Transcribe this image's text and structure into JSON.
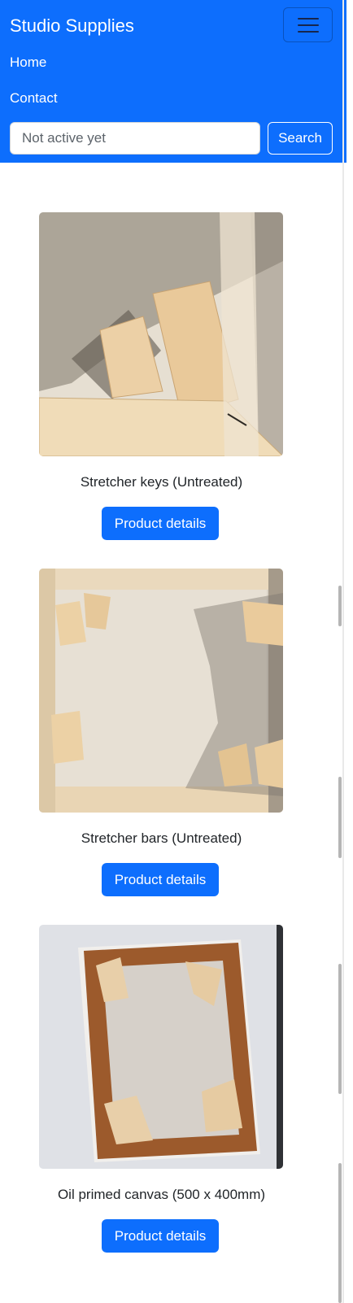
{
  "navbar": {
    "brand": "Studio Supplies",
    "links": [
      {
        "label": "Home"
      },
      {
        "label": "Contact"
      }
    ],
    "search": {
      "placeholder": "Not active yet",
      "value": "",
      "button_label": "Search"
    }
  },
  "products": [
    {
      "name": "Stretcher keys (Untreated)",
      "button_label": "Product details",
      "image": "stretcher-keys-photo"
    },
    {
      "name": "Stretcher bars (Untreated)",
      "button_label": "Product details",
      "image": "stretcher-bars-photo"
    },
    {
      "name": "Oil primed canvas (500 x 400mm)",
      "button_label": "Product details",
      "image": "oil-primed-canvas-photo"
    }
  ],
  "colors": {
    "accent": "#0d6efd",
    "text": "#212529",
    "page_background": "#ffffff"
  },
  "icons": {
    "menu_toggle": "hamburger-menu-icon"
  }
}
